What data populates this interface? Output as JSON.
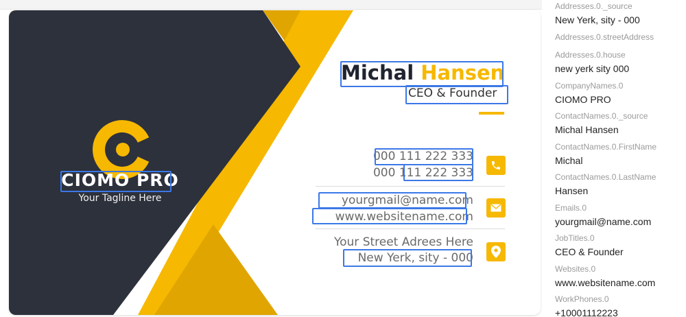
{
  "card": {
    "company_name": "CIOMO PRO",
    "tagline": "Your Tagline Here",
    "first_name": "Michal",
    "last_name": "Hansen",
    "job_title": "CEO & Founder",
    "phone_1": "000 111 222 333",
    "phone_2": "000 111 222 333",
    "email": "yourgmail@name.com",
    "website": "www.websitename.com",
    "street": "Your Street Adrees Here",
    "city": "New Yerk, sity - 000"
  },
  "colors": {
    "navy": "#2d313c",
    "yellow": "#f6b800",
    "dark_yellow": "#e0a500",
    "highlight": "#3b78e7"
  },
  "icons": [
    "phone-icon",
    "mail-icon",
    "location-pin-icon"
  ],
  "fields": [
    {
      "key": "Addresses.0._source",
      "value": "New Yerk, sity - 000"
    },
    {
      "key": "Addresses.0.streetAddress",
      "value": ""
    },
    {
      "key": "Addresses.0.house",
      "value": "new yerk sity 000"
    },
    {
      "key": "CompanyNames.0",
      "value": "CIOMO PRO"
    },
    {
      "key": "ContactNames.0._source",
      "value": "Michal Hansen"
    },
    {
      "key": "ContactNames.0.FirstName",
      "value": "Michal"
    },
    {
      "key": "ContactNames.0.LastName",
      "value": "Hansen"
    },
    {
      "key": "Emails.0",
      "value": "yourgmail@name.com"
    },
    {
      "key": "JobTitles.0",
      "value": "CEO & Founder"
    },
    {
      "key": "Websites.0",
      "value": "www.websitename.com"
    },
    {
      "key": "WorkPhones.0",
      "value": "+10001112223"
    }
  ]
}
